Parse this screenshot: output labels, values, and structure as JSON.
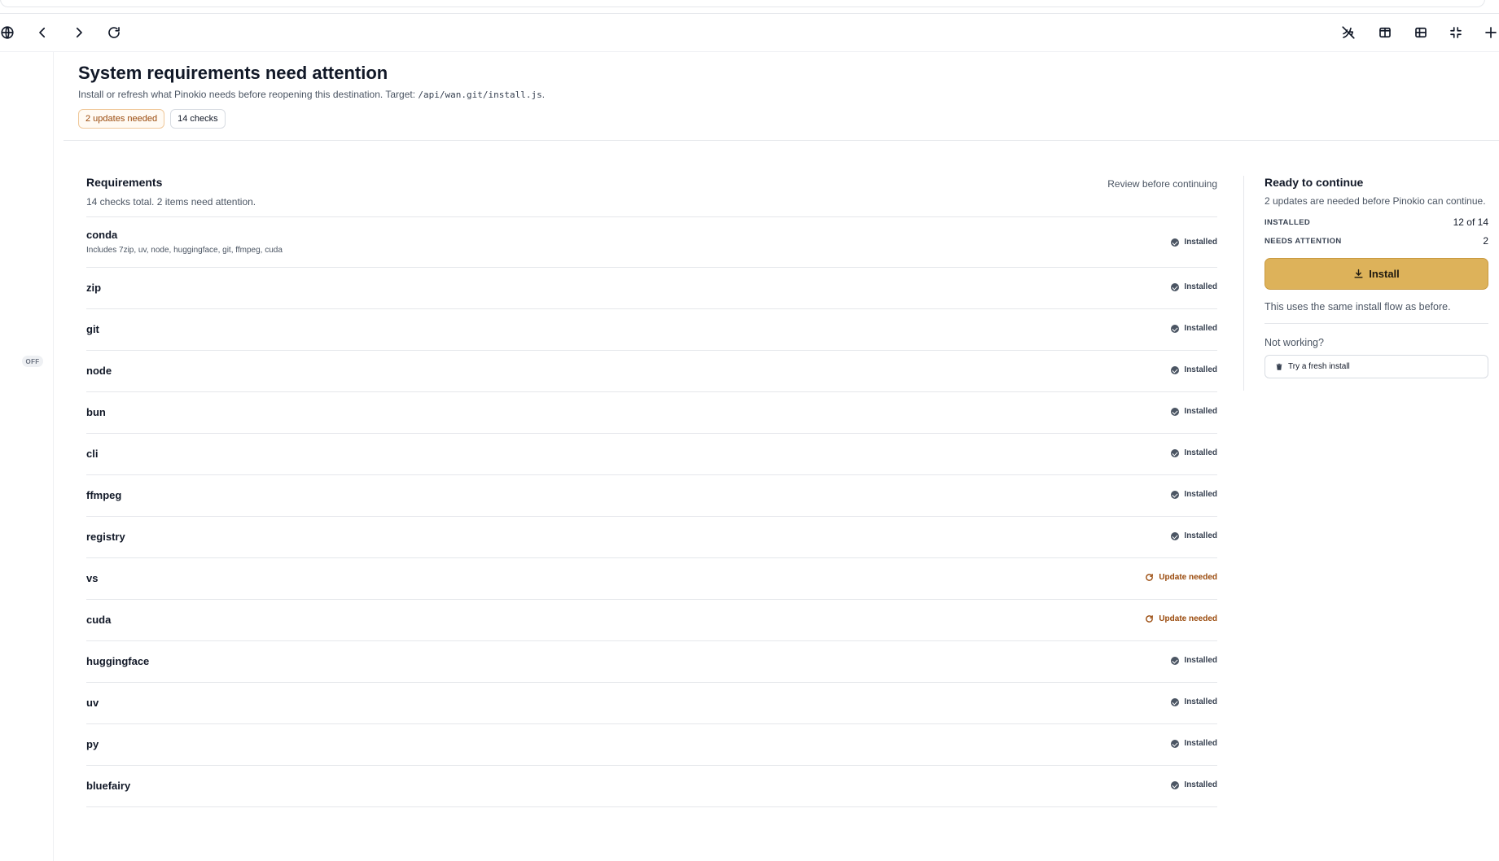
{
  "header": {
    "title": "System requirements need attention",
    "desc_prefix": "Install or refresh what Pinokio needs before reopening this destination. Target: ",
    "target": "/api/wan.git/install.js",
    "desc_suffix": ".",
    "pill_updates": "2 updates needed",
    "pill_checks": "14 checks"
  },
  "rail": {
    "off_label": "OFF"
  },
  "requirements": {
    "title": "Requirements",
    "subtitle": "14 checks total. 2 items need attention.",
    "review": "Review before continuing",
    "items": [
      {
        "name": "conda",
        "detail": "Includes 7zip, uv, node, huggingface, git, ffmpeg, cuda",
        "status": "Installed"
      },
      {
        "name": "zip",
        "status": "Installed"
      },
      {
        "name": "git",
        "status": "Installed"
      },
      {
        "name": "node",
        "status": "Installed"
      },
      {
        "name": "bun",
        "status": "Installed"
      },
      {
        "name": "cli",
        "status": "Installed"
      },
      {
        "name": "ffmpeg",
        "status": "Installed"
      },
      {
        "name": "registry",
        "status": "Installed"
      },
      {
        "name": "vs",
        "status": "Update needed"
      },
      {
        "name": "cuda",
        "status": "Update needed"
      },
      {
        "name": "huggingface",
        "status": "Installed"
      },
      {
        "name": "uv",
        "status": "Installed"
      },
      {
        "name": "py",
        "status": "Installed"
      },
      {
        "name": "bluefairy",
        "status": "Installed"
      }
    ]
  },
  "side": {
    "title": "Ready to continue",
    "subtitle": "2 updates are needed before Pinokio can continue.",
    "installed_label": "INSTALLED",
    "installed_value": "12 of 14",
    "attention_label": "NEEDS ATTENTION",
    "attention_value": "2",
    "install_label": "Install",
    "note": "This uses the same install flow as before.",
    "not_working": "Not working?",
    "fresh_label": "Try a fresh install"
  },
  "colors": {
    "accent": "#ddb25a",
    "warning_text": "#9a4a0c",
    "installed_dot": "#4b5563"
  },
  "icons": {
    "nav": [
      "globe-icon",
      "chevron-left-icon",
      "chevron-right-icon",
      "refresh-icon"
    ],
    "toolbar": [
      "signal-off-icon",
      "columns-icon",
      "rows-icon",
      "minimize-icon",
      "plus-icon"
    ]
  }
}
